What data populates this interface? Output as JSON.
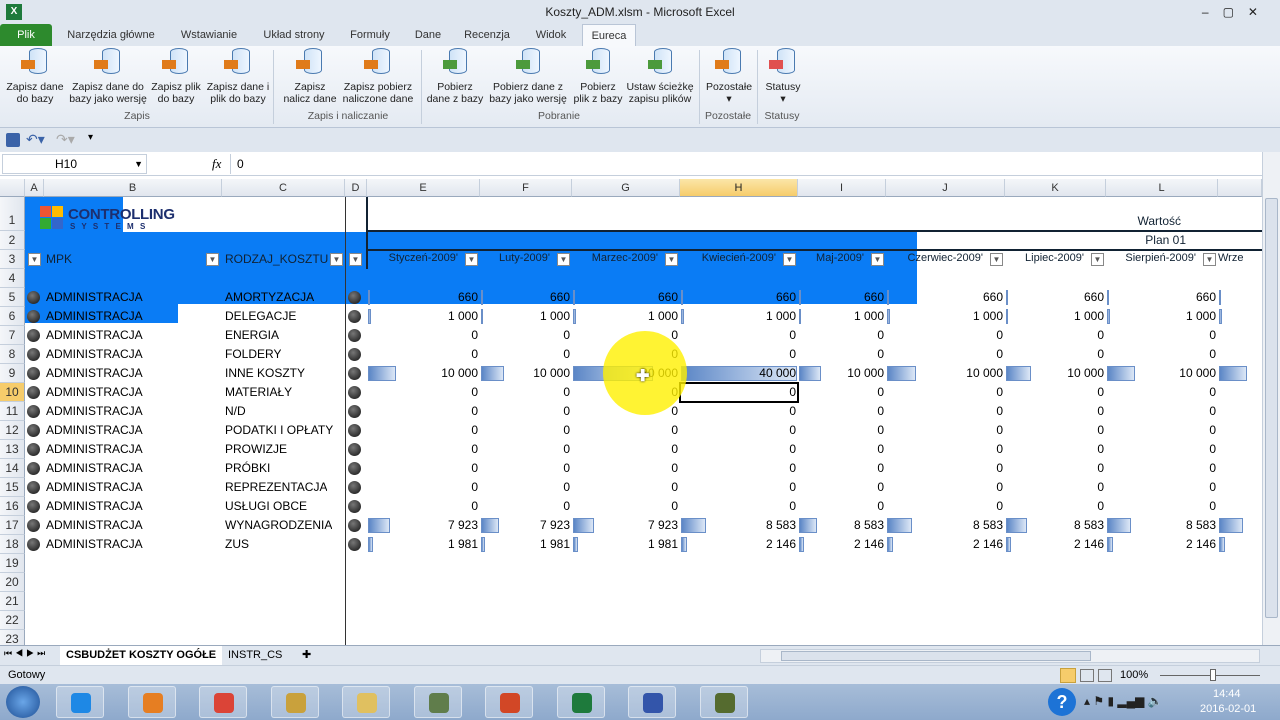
{
  "window": {
    "title": "Koszty_ADM.xlsm - Microsoft Excel"
  },
  "tabs": [
    {
      "label": "Plik"
    },
    {
      "label": "Narzędzia główne"
    },
    {
      "label": "Wstawianie"
    },
    {
      "label": "Układ strony"
    },
    {
      "label": "Formuły"
    },
    {
      "label": "Dane"
    },
    {
      "label": "Recenzja"
    },
    {
      "label": "Widok"
    },
    {
      "label": "Eureca",
      "active": true
    }
  ],
  "ribbon": {
    "buttons": [
      {
        "l1": "Zapisz dane",
        "l2": "do bazy"
      },
      {
        "l1": "Zapisz dane do",
        "l2": "bazy jako wersję"
      },
      {
        "l1": "Zapisz plik",
        "l2": "do bazy"
      },
      {
        "l1": "Zapisz dane i",
        "l2": "plik do bazy"
      },
      {
        "l1": "Zapisz",
        "l2": "nalicz dane"
      },
      {
        "l1": "Zapisz pobierz",
        "l2": "naliczone dane"
      },
      {
        "l1": "Pobierz",
        "l2": "dane z bazy"
      },
      {
        "l1": "Pobierz dane z",
        "l2": "bazy jako wersję"
      },
      {
        "l1": "Pobierz",
        "l2": "plik z bazy"
      },
      {
        "l1": "Ustaw ścieżkę",
        "l2": "zapisu plików"
      },
      {
        "l1": "Pozostałe",
        "l2": "▾"
      },
      {
        "l1": "Statusy",
        "l2": "▾"
      }
    ],
    "groups": [
      "Zapis",
      "Zapis i naliczanie",
      "Pobranie",
      "Pozostałe",
      "Statusy"
    ]
  },
  "formula_bar": {
    "name_box": "H10",
    "fx": "fx",
    "value": "0"
  },
  "columns": [
    "A",
    "B",
    "C",
    "D",
    "E",
    "F",
    "G",
    "H",
    "I",
    "J",
    "K",
    "L"
  ],
  "logo": {
    "line1": "CONTROLLING",
    "line2": "S Y S T E M S"
  },
  "header": {
    "row1": "Wartość",
    "row2": "Plan 01",
    "mpk": "MPK",
    "rodzaj": "RODZAJ_KOSZTU",
    "months": [
      "Styczeń-2009'",
      "Luty-2009'",
      "Marzec-2009'",
      "Kwiecień-2009'",
      "Maj-2009'",
      "Czerwiec-2009'",
      "Lipiec-2009'",
      "Sierpień-2009'",
      "Wrze"
    ]
  },
  "rows": [
    {
      "mpk": "ADMINISTRACJA",
      "rodzaj": "AMORTYZACJA",
      "values": [
        660,
        660,
        660,
        660,
        660,
        660,
        660,
        660
      ]
    },
    {
      "mpk": "ADMINISTRACJA",
      "rodzaj": "DELEGACJE",
      "values": [
        1000,
        1000,
        1000,
        1000,
        1000,
        1000,
        1000,
        1000
      ]
    },
    {
      "mpk": "ADMINISTRACJA",
      "rodzaj": "ENERGIA",
      "values": [
        0,
        0,
        0,
        0,
        0,
        0,
        0,
        0
      ]
    },
    {
      "mpk": "ADMINISTRACJA",
      "rodzaj": "FOLDERY",
      "values": [
        0,
        0,
        0,
        0,
        0,
        0,
        0,
        0
      ]
    },
    {
      "mpk": "ADMINISTRACJA",
      "rodzaj": "INNE KOSZTY",
      "values": [
        10000,
        10000,
        30000,
        40000,
        10000,
        10000,
        10000,
        10000
      ]
    },
    {
      "mpk": "ADMINISTRACJA",
      "rodzaj": "MATERIAŁY",
      "values": [
        0,
        0,
        0,
        0,
        0,
        0,
        0,
        0
      ]
    },
    {
      "mpk": "ADMINISTRACJA",
      "rodzaj": "N/D",
      "values": [
        0,
        0,
        0,
        0,
        0,
        0,
        0,
        0
      ]
    },
    {
      "mpk": "ADMINISTRACJA",
      "rodzaj": "PODATKI I OPŁATY",
      "values": [
        0,
        0,
        0,
        0,
        0,
        0,
        0,
        0
      ]
    },
    {
      "mpk": "ADMINISTRACJA",
      "rodzaj": "PROWIZJE",
      "values": [
        0,
        0,
        0,
        0,
        0,
        0,
        0,
        0
      ]
    },
    {
      "mpk": "ADMINISTRACJA",
      "rodzaj": "PRÓBKI",
      "values": [
        0,
        0,
        0,
        0,
        0,
        0,
        0,
        0
      ]
    },
    {
      "mpk": "ADMINISTRACJA",
      "rodzaj": "REPREZENTACJA",
      "values": [
        0,
        0,
        0,
        0,
        0,
        0,
        0,
        0
      ]
    },
    {
      "mpk": "ADMINISTRACJA",
      "rodzaj": "USŁUGI OBCE",
      "values": [
        0,
        0,
        0,
        0,
        0,
        0,
        0,
        0
      ]
    },
    {
      "mpk": "ADMINISTRACJA",
      "rodzaj": "WYNAGRODZENIA",
      "values": [
        7923,
        7923,
        7923,
        8583,
        8583,
        8583,
        8583,
        8583
      ]
    },
    {
      "mpk": "ADMINISTRACJA",
      "rodzaj": "ZUS",
      "values": [
        1981,
        1981,
        1981,
        2146,
        2146,
        2146,
        2146,
        2146
      ]
    }
  ],
  "selected_cell": "H10",
  "sheets": [
    {
      "label": "CSBUDŻET KOSZTY OGÓŁE",
      "active": true
    },
    {
      "label": "INSTR_CS"
    }
  ],
  "status": {
    "text": "Gotowy",
    "zoom": "100%"
  },
  "taskbar": {
    "time": "14:44",
    "date": "2016-02-01"
  }
}
